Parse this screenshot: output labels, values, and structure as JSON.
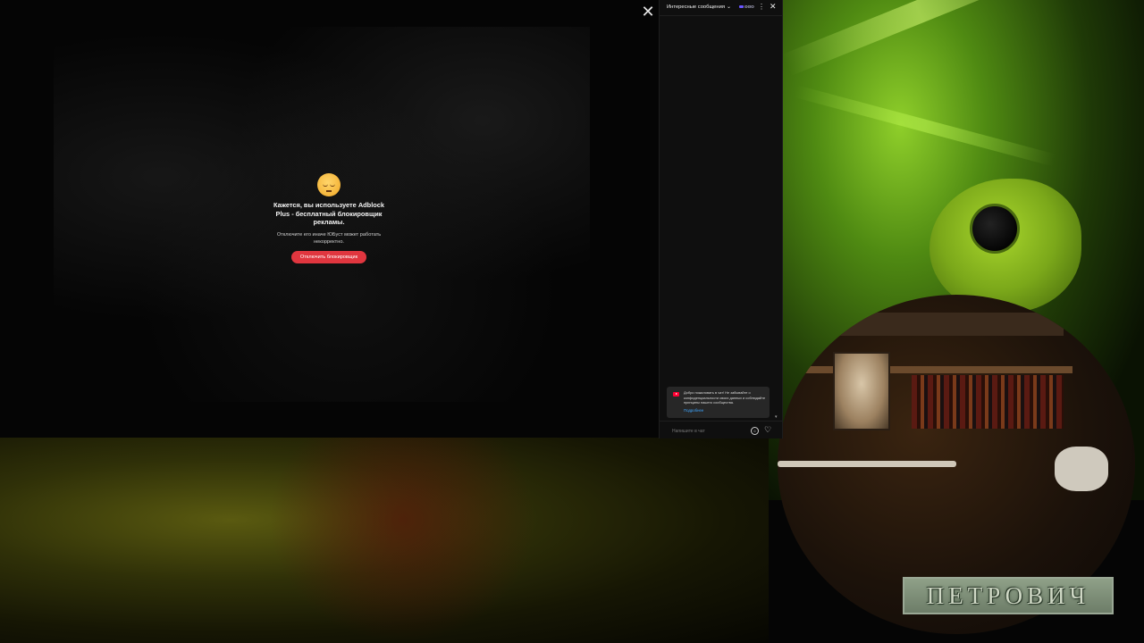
{
  "player": {
    "title": "",
    "close_icon": "close-icon",
    "close_glyph": "✕"
  },
  "adblock_modal": {
    "emoji": "pensive-face-emoji",
    "title": "Кажется, вы используете Adblock Plus - бесплатный блокировщик рекламы.",
    "subtitle": "Отключите его иначе ЮБуст может работать некорректно.",
    "button_label": "Отключить блокировщик",
    "button_color": "#e0363f"
  },
  "chat": {
    "mode_label": "Интересные сообщения",
    "mode_chevron": "⌄",
    "badge_label": "ΘΘΘ",
    "more_glyph": "⋮",
    "close_glyph": "✕",
    "scroll_arrow": "▾",
    "welcome_text": "Добро пожаловать в чат! Не забывайте о конфиденциальности своих данных и соблюдайте принципы нашего сообщества.",
    "welcome_link": "Подробнее",
    "input_placeholder": "Напишите в чат",
    "emoji_glyph": "☺",
    "heart_glyph": "♡"
  },
  "overlay_logo": {
    "text": "ПЕТРОВИЧ"
  },
  "colors": {
    "chat_bg": "#0f0f0f",
    "accent_red": "#e0363f",
    "link_blue": "#3ea6ff"
  }
}
